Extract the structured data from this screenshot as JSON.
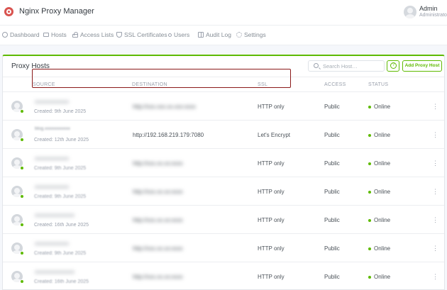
{
  "app": {
    "title": "Nginx Proxy Manager"
  },
  "user": {
    "name": "Admin",
    "role": "Administrator"
  },
  "nav": [
    {
      "label": "Dashboard",
      "icon": "house-icon"
    },
    {
      "label": "Hosts",
      "icon": "monitor-icon"
    },
    {
      "label": "Access Lists",
      "icon": "lock-icon"
    },
    {
      "label": "SSL Certificates",
      "icon": "shield-icon"
    },
    {
      "label": "Users",
      "icon": "users-icon"
    },
    {
      "label": "Audit Log",
      "icon": "book-icon"
    },
    {
      "label": "Settings",
      "icon": "gear-icon"
    }
  ],
  "card": {
    "title": "Proxy Hosts",
    "search_placeholder": "Search Host…",
    "help_label": "?",
    "add_button": "Add Proxy Host"
  },
  "columns": {
    "source": "SOURCE",
    "destination": "DESTINATION",
    "ssl": "SSL",
    "access": "ACCESS",
    "status": "STATUS"
  },
  "rows": [
    {
      "source": "xxxxxxxxxxxx",
      "created": "Created: 9th June 2025",
      "destination": "http://xxx.xxx.xx.xxx:xxxx",
      "ssl": "HTTP only",
      "access": "Public",
      "status": "Online",
      "menu": "⋮"
    },
    {
      "source": "blog.xxxxxxxxxxx",
      "created": "Created: 12th June 2025",
      "destination": "http://192.168.219.179:7080",
      "ssl": "Let's Encrypt",
      "access": "Public",
      "status": "Online",
      "menu": "⋮"
    },
    {
      "source": "xxxxxxxxxxxx",
      "created": "Created: 9th June 2025",
      "destination": "http://xxx.xx.xx:xxxx",
      "ssl": "HTTP only",
      "access": "Public",
      "status": "Online",
      "menu": "⋮"
    },
    {
      "source": "xxxxxxxxxxxx",
      "created": "Created: 9th June 2025",
      "destination": "http://xxx.xx.xx:xxxx",
      "ssl": "HTTP only",
      "access": "Public",
      "status": "Online",
      "menu": "⋮"
    },
    {
      "source": "xxxxxxxxxxxxxx",
      "created": "Created: 16th June 2025",
      "destination": "http://xxx.xx.xx:xxxx",
      "ssl": "HTTP only",
      "access": "Public",
      "status": "Online",
      "menu": "⋮"
    },
    {
      "source": "xxxxxxxxxxxx",
      "created": "Created: 9th June 2025",
      "destination": "http://xxx.xx.xx:xxxx",
      "ssl": "HTTP only",
      "access": "Public",
      "status": "Online",
      "menu": "⋮"
    },
    {
      "source": "xxxxxxxxxxxxxx",
      "created": "Created: 16th June 2025",
      "destination": "http://xxx.xx.xx:xxxx",
      "ssl": "HTTP only",
      "access": "Public",
      "status": "Online",
      "menu": "⋮"
    }
  ],
  "colors": {
    "accent": "#5eba00",
    "brand": "#d9534f",
    "highlight": "#8b1a1a"
  }
}
